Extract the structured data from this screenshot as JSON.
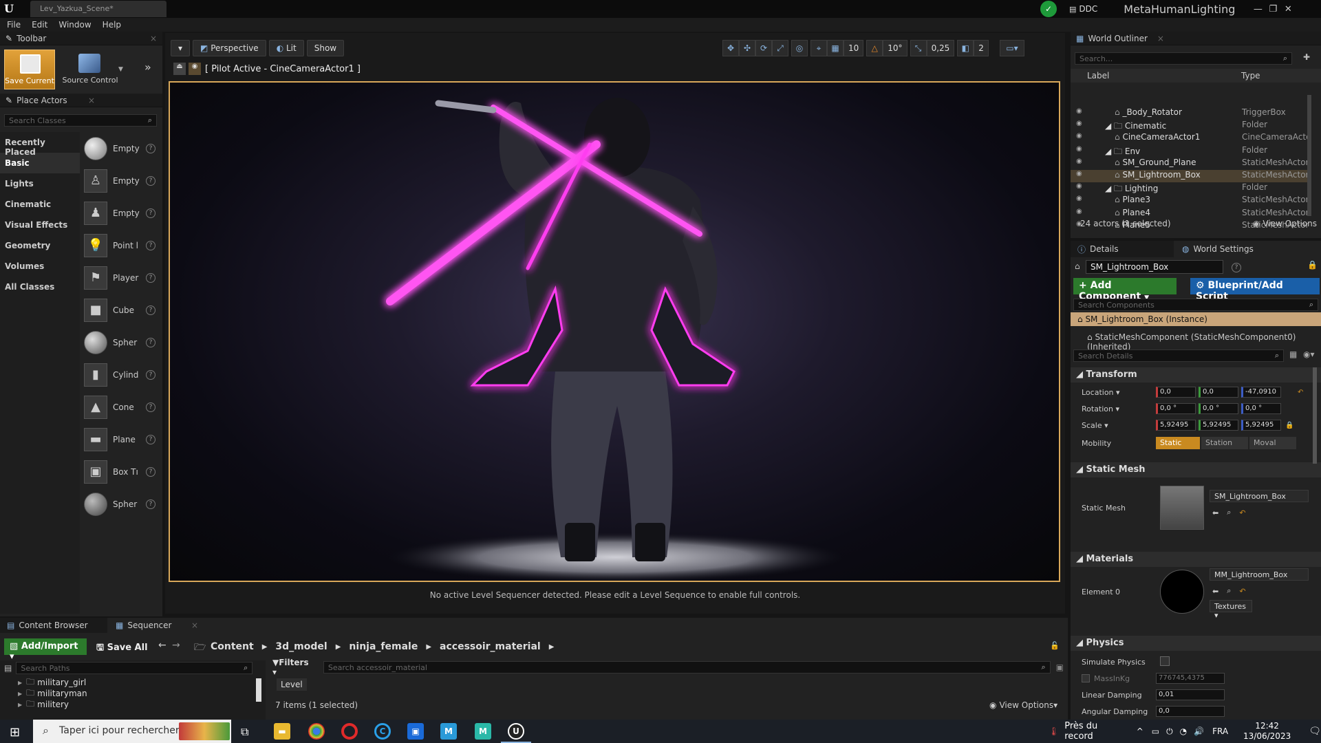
{
  "titlebar": {
    "doc_tab": "Lev_Yazkua_Scene*",
    "ddc_label": "DDC",
    "project_name": "MetaHumanLighting",
    "controls": [
      "—",
      "❐",
      "✕"
    ]
  },
  "menu": [
    "File",
    "Edit",
    "Window",
    "Help"
  ],
  "toolbar": {
    "title": "Toolbar",
    "save_label": "Save Current",
    "source_control_label": "Source Control"
  },
  "place_actors": {
    "title": "Place Actors",
    "search_placeholder": "Search Classes",
    "categories": [
      "Recently Placed",
      "Basic",
      "Lights",
      "Cinematic",
      "Visual Effects",
      "Geometry",
      "Volumes",
      "All Classes"
    ],
    "active_category": "Basic",
    "actors": [
      "Empty",
      "Empty",
      "Empty",
      "Point l",
      "Player",
      "Cube",
      "Spher",
      "Cylind",
      "Cone",
      "Plane",
      "Box Tı",
      "Spher"
    ]
  },
  "viewport": {
    "perspective_label": "Perspective",
    "lit_label": "Lit",
    "show_label": "Show",
    "grid_value": "10",
    "rotation_snap": "10°",
    "scale_snap": "0,25",
    "camera_speed": "2",
    "pilot_text": "[ Pilot Active - CineCameraActor1 ]",
    "sequencer_message": "No active Level Sequencer detected. Please edit a Level Sequence to enable full controls."
  },
  "outliner": {
    "title": "World Outliner",
    "search_placeholder": "Search...",
    "col_label": "Label",
    "col_type": "Type",
    "rows": [
      {
        "label": "_Body_Rotator",
        "type": "TriggerBox",
        "indent": 2,
        "folder": false,
        "selected": false
      },
      {
        "label": "Cinematic",
        "type": "Folder",
        "indent": 1,
        "folder": true,
        "selected": false
      },
      {
        "label": "CineCameraActor1",
        "type": "CineCameraActo",
        "indent": 2,
        "folder": false,
        "selected": false
      },
      {
        "label": "Env",
        "type": "Folder",
        "indent": 1,
        "folder": true,
        "selected": false
      },
      {
        "label": "SM_Ground_Plane",
        "type": "StaticMeshActor",
        "indent": 2,
        "folder": false,
        "selected": false
      },
      {
        "label": "SM_Lightroom_Box",
        "type": "StaticMeshActor",
        "indent": 2,
        "folder": false,
        "selected": true
      },
      {
        "label": "Lighting",
        "type": "Folder",
        "indent": 1,
        "folder": true,
        "selected": false
      },
      {
        "label": "Plane3",
        "type": "StaticMeshActor",
        "indent": 2,
        "folder": false,
        "selected": false
      },
      {
        "label": "Plane4",
        "type": "StaticMeshActor",
        "indent": 2,
        "folder": false,
        "selected": false
      },
      {
        "label": "Plane5",
        "type": "StaticMeshActor",
        "indent": 2,
        "folder": false,
        "selected": false
      }
    ],
    "footer_count": "24 actors (1 selected)",
    "view_options": "View Options"
  },
  "details": {
    "tab_details": "Details",
    "tab_world_settings": "World Settings",
    "actor_name": "SM_Lightroom_Box",
    "add_component": "+ Add Component",
    "blueprint": "Blueprint/Add Script",
    "search_components": "Search Components",
    "instance_row": "SM_Lightroom_Box (Instance)",
    "component_row": "StaticMeshComponent (StaticMeshComponent0) (Inherited)",
    "search_details": "Search Details",
    "transform": {
      "title": "Transform",
      "location_label": "Location",
      "rotation_label": "Rotation",
      "scale_label": "Scale",
      "mobility_label": "Mobility",
      "location": [
        "0,0",
        "0,0",
        "-47,0910"
      ],
      "rotation": [
        "0,0 °",
        "0,0 °",
        "0,0 °"
      ],
      "scale": [
        "5,92495",
        "5,92495",
        "5,92495"
      ],
      "mobility": [
        "Static",
        "Station",
        "Moval"
      ]
    },
    "static_mesh": {
      "title": "Static Mesh",
      "label": "Static Mesh",
      "value": "SM_Lightroom_Box"
    },
    "materials": {
      "title": "Materials",
      "element_label": "Element 0",
      "value": "MM_Lightroom_Box",
      "textures": "Textures"
    },
    "physics": {
      "title": "Physics",
      "simulate_label": "Simulate Physics",
      "mass_label": "MassInKg",
      "mass_value": "776745,4375",
      "linear_label": "Linear Damping",
      "linear_value": "0,01",
      "angular_label": "Angular Damping",
      "angular_value": "0,0"
    }
  },
  "content_browser": {
    "tab_cb": "Content Browser",
    "tab_seq": "Sequencer",
    "add_import": "Add/Import",
    "save_all": "Save All",
    "breadcrumbs": [
      "Content",
      "3d_model",
      "ninja_female",
      "accessoir_material"
    ],
    "search_paths": "Search Paths",
    "filters": "Filters",
    "search_assets": "Search accessoir_material",
    "folders": [
      "military_girl",
      "militaryman",
      "militery"
    ],
    "level_chip": "Level",
    "item_count": "7 items (1 selected)",
    "view_options": "View Options"
  },
  "taskbar": {
    "search_placeholder": "Taper ici pour rechercher",
    "weather": "Près du record",
    "language": "FRA",
    "time": "12:42",
    "date": "13/06/2023"
  },
  "colors": {
    "accent_orange": "#d9a85a",
    "neon_pink": "#ff3cf0",
    "add_green": "#2c7a2c",
    "blueprint_blue": "#1a5fa8"
  }
}
